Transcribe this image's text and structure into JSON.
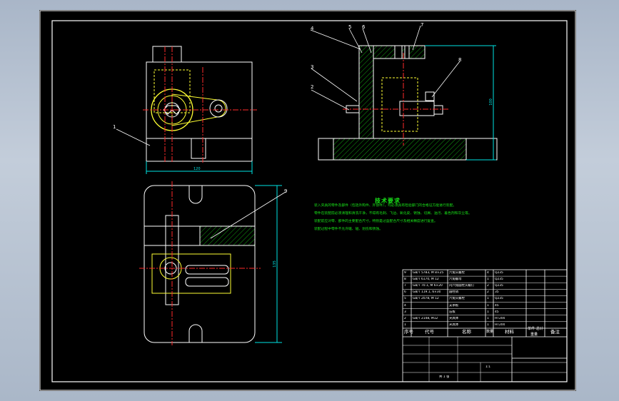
{
  "colors": {
    "sheet": "#000000",
    "frame": "#ffffff",
    "part": "#ffffff",
    "centerline": "#ff2a2a",
    "hidden": "#ffff33",
    "hatch": "#19e619",
    "dim": "#00e5e5",
    "leader": "#ffffff",
    "text_green": "#19e619"
  },
  "balloons": {
    "one": "1",
    "two": "2",
    "three": "3",
    "four": "4",
    "five": "5",
    "six": "6",
    "seven": "7",
    "eight": "8",
    "nine": "9"
  },
  "dims": {
    "front_width": "120",
    "side_height": "100",
    "top_height": "135"
  },
  "tech_req": {
    "title": "技术要求",
    "lines": [
      "装入夹具的零件及部件（包括外购件、外协件），均必须具有检验部门的合格证方能进行装配。",
      "零件在装配前必须清理和清洗干净，不得有毛刺、飞边、氧化皮、锈蚀、切屑、油污、着色剂和灰尘等。",
      "装配前应对零、部件的主要配合尺寸，特别是过盈配合尺寸及相关精度进行复查。",
      "装配过程中零件不允许磕、碰、划伤和锈蚀。"
    ]
  },
  "bom": {
    "rows": [
      {
        "no": "9",
        "code": "GB/T 5783, M 8×25",
        "name": "六角头螺栓",
        "qty": "4",
        "mat": "Q235",
        "note": ""
      },
      {
        "no": "8",
        "code": "GB/T 6170, M 12",
        "name": "六角螺母",
        "qty": "1",
        "mat": "Q235",
        "note": ""
      },
      {
        "no": "7",
        "code": "GB/T 70.1, M 6×20",
        "name": "内六角圆柱头螺钉",
        "qty": "2",
        "mat": "Q235",
        "note": ""
      },
      {
        "no": "6",
        "code": "GB/T 119.1, 6×30",
        "name": "圆柱销",
        "qty": "2",
        "mat": "35",
        "note": ""
      },
      {
        "no": "5",
        "code": "GB/T 2078, M 12",
        "name": "六角头螺栓",
        "qty": "1",
        "mat": "Q235",
        "note": ""
      },
      {
        "no": "4",
        "code": "",
        "name": "支承板",
        "qty": "1",
        "mat": "45",
        "note": ""
      },
      {
        "no": "3",
        "code": "",
        "name": "压板",
        "qty": "1",
        "mat": "45",
        "note": ""
      },
      {
        "no": "2",
        "code": "GB/T 2148, M12",
        "name": "夹具体",
        "qty": "1",
        "mat": "HT200",
        "note": ""
      },
      {
        "no": "1",
        "code": "",
        "name": "夹具体",
        "qty": "1",
        "mat": "HT200",
        "note": ""
      }
    ],
    "headers": {
      "no": "序号",
      "code": "代号",
      "name": "名称",
      "qty": "数量",
      "mat": "材料",
      "single": "单件",
      "total": "总计",
      "weight": "重量",
      "note": "备注"
    }
  },
  "title_block": {
    "scale": "1:1",
    "sheet": "共 1 张"
  }
}
